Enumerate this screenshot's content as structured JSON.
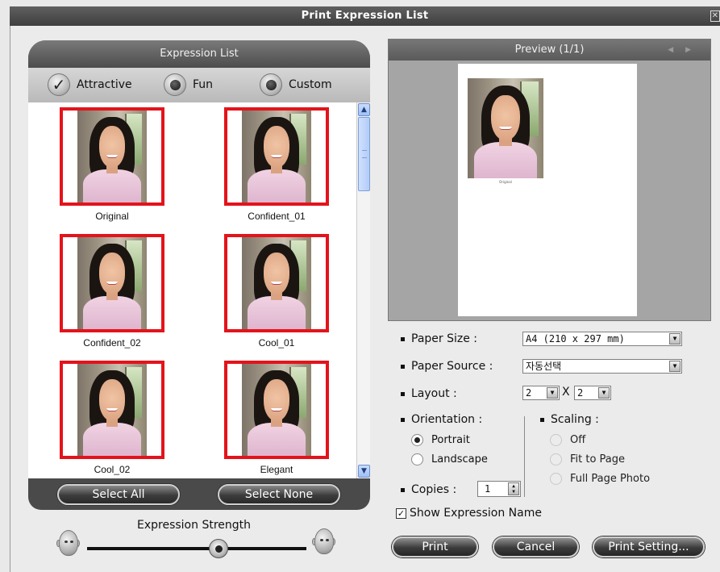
{
  "window": {
    "title": "Print Expression List"
  },
  "expression_panel": {
    "title": "Expression List",
    "filters": [
      {
        "label": "Attractive",
        "state": "checked"
      },
      {
        "label": "Fun",
        "state": "unchecked"
      },
      {
        "label": "Custom",
        "state": "unchecked"
      }
    ],
    "thumbnails": [
      "Original",
      "Confident_01",
      "Confident_02",
      "Cool_01",
      "Cool_02",
      "Elegant"
    ],
    "select_all_label": "Select All",
    "select_none_label": "Select None",
    "strength_label": "Expression Strength",
    "strength_value": 0.6
  },
  "preview": {
    "title": "Preview (1/1)",
    "page_items": [
      "Original"
    ]
  },
  "settings": {
    "paper_size": {
      "label": "Paper Size :",
      "value": "A4 (210 x 297 mm)"
    },
    "paper_source": {
      "label": "Paper Source :",
      "value": "자동선택"
    },
    "layout": {
      "label": "Layout :",
      "cols": "2",
      "rows": "2",
      "times": "X"
    },
    "orientation": {
      "label": "Orientation :",
      "options": [
        "Portrait",
        "Landscape"
      ],
      "selected": "Portrait"
    },
    "scaling": {
      "label": "Scaling :",
      "options": [
        "Off",
        "Fit to Page",
        "Full Page Photo"
      ],
      "enabled": false
    },
    "copies": {
      "label": "Copies :",
      "value": "1"
    },
    "show_name": {
      "label": "Show Expression Name",
      "checked": true
    }
  },
  "buttons": {
    "print": "Print",
    "cancel": "Cancel",
    "print_setting": "Print Setting..."
  },
  "colors": {
    "accent_frame": "#e4131b",
    "panel_dark": "#4a4a4a",
    "scroll_blue": "#9fbff5"
  },
  "icons": {
    "check": "check-icon",
    "radio": "radio-icon",
    "head_min": "neutral-face-icon",
    "head_max": "expressive-face-icon"
  }
}
